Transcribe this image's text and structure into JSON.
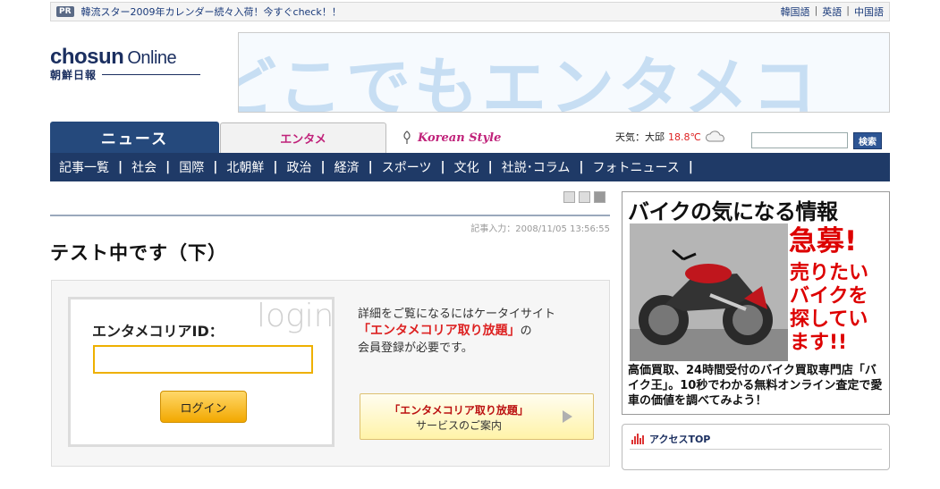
{
  "topbar": {
    "pr_badge": "PR",
    "pr_text": "韓流スター2009年カレンダー続々入荷！今すぐcheck！！",
    "languages": [
      "韓国語",
      "英語",
      "中国語"
    ]
  },
  "logo": {
    "brand": "chosun",
    "online": "Online",
    "subtitle": "朝鮮日報"
  },
  "banner": {
    "text": "どこでもエンタメコ"
  },
  "nav": {
    "tabs": {
      "news": "ニュース",
      "enta": "エンタメ",
      "korean": "Korean Style"
    },
    "weather": {
      "label": "天気：大邱",
      "temp": "18.8℃"
    },
    "search": {
      "placeholder": "",
      "button": "検索"
    },
    "subnav": [
      "記事一覧",
      "社会",
      "国際",
      "北朝鮮",
      "政治",
      "経済",
      "スポーツ",
      "文化",
      "社説･コラム",
      "フォトニュース"
    ]
  },
  "article": {
    "dateline": "記事入力：2008/11/05 13:56:55",
    "headline": "テスト中です（下）"
  },
  "login": {
    "watermark": "login",
    "id_label": "エンタメコリアID：",
    "id_value": "",
    "button": "ログイン",
    "info_line1": "詳細をご覧になるにはケータイサイト",
    "info_highlight": "「エンタメコリア取り放題」",
    "info_suffix": "の",
    "info_line3": "会員登録が必要です。",
    "service_line1": "「エンタメコリア取り放題」",
    "service_line2": "サービスのご案内"
  },
  "ad": {
    "title": "バイクの気になる情報",
    "red1": "急募!",
    "red2_lines": [
      "売りたい",
      "バイクを",
      "探してい",
      "ます!!"
    ],
    "body": "高価買取、24時間受付のバイク買取専門店「バイク王」。10秒でわかる無料オンライン査定で愛車の価値を調べてみよう！"
  },
  "access": {
    "title": "アクセスTOP"
  },
  "colors": {
    "nav_blue": "#25497c",
    "subnav_blue": "#1f3a67",
    "enta_pink": "#c0227a",
    "login_yellow": "#f2a800",
    "ad_red": "#d00"
  }
}
